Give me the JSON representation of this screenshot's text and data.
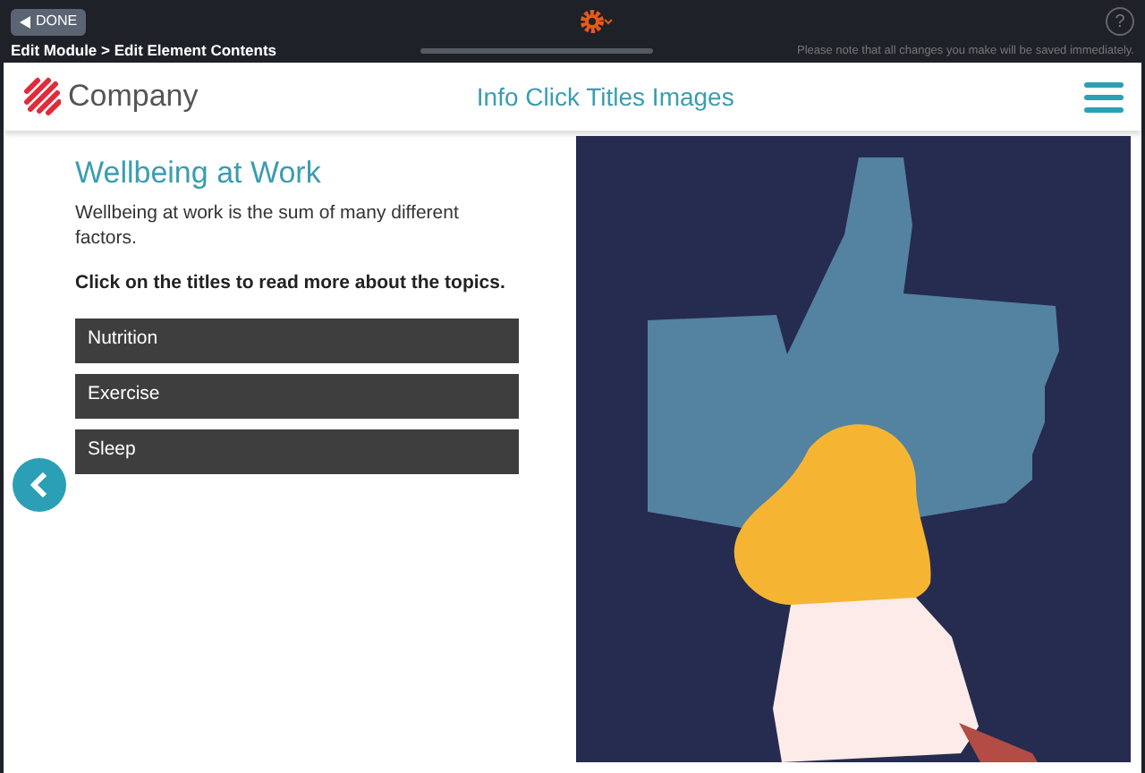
{
  "toolbar": {
    "done_button": "DONE",
    "breadcrumb": "Edit Module > Edit Element Contents",
    "notice": "Please note that all changes you make will be saved immediately.",
    "help": "?"
  },
  "header": {
    "brand": "Company",
    "title": "Info Click Titles Images"
  },
  "content": {
    "heading": "Wellbeing at Work",
    "intro": "Wellbeing at work is the sum of many different factors.",
    "instruction": "Click on the titles to read more about the topics.",
    "titles": [
      {
        "label": "Nutrition"
      },
      {
        "label": "Exercise"
      },
      {
        "label": "Sleep"
      }
    ]
  }
}
